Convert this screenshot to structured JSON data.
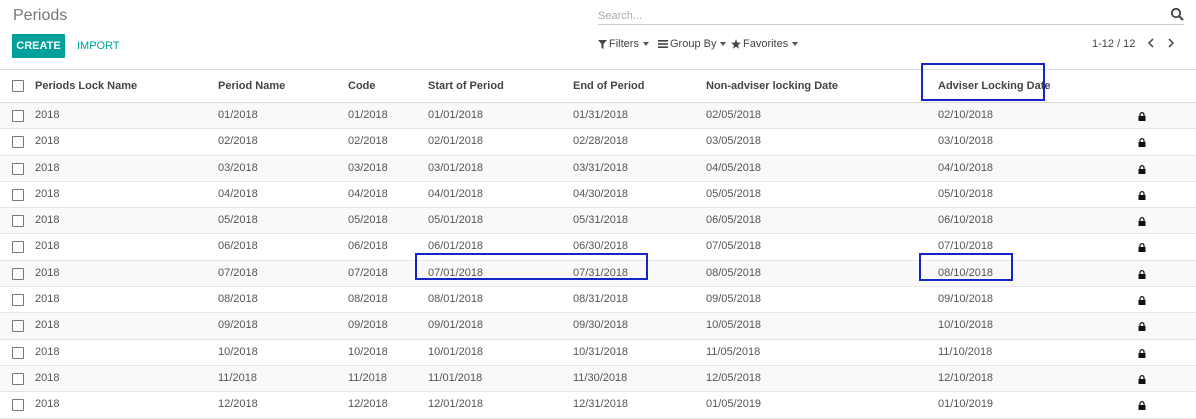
{
  "page": {
    "title": "Periods"
  },
  "search": {
    "placeholder": "Search..."
  },
  "toolbar": {
    "create_label": "CREATE",
    "import_label": "IMPORT",
    "filters_label": "Filters",
    "groupby_label": "Group By",
    "favorites_label": "Favorites",
    "pager_text": "1-12 / 12"
  },
  "accent_color": "#00a09d",
  "highlight_color": "#1426c8",
  "columns": [
    "Periods Lock Name",
    "Period Name",
    "Code",
    "Start of Period",
    "End of Period",
    "Non-adviser locking Date",
    "Adviser Locking Date"
  ],
  "rows": [
    [
      "2018",
      "01/2018",
      "01/2018",
      "01/01/2018",
      "01/31/2018",
      "02/05/2018",
      "02/10/2018"
    ],
    [
      "2018",
      "02/2018",
      "02/2018",
      "02/01/2018",
      "02/28/2018",
      "03/05/2018",
      "03/10/2018"
    ],
    [
      "2018",
      "03/2018",
      "03/2018",
      "03/01/2018",
      "03/31/2018",
      "04/05/2018",
      "04/10/2018"
    ],
    [
      "2018",
      "04/2018",
      "04/2018",
      "04/01/2018",
      "04/30/2018",
      "05/05/2018",
      "05/10/2018"
    ],
    [
      "2018",
      "05/2018",
      "05/2018",
      "05/01/2018",
      "05/31/2018",
      "06/05/2018",
      "06/10/2018"
    ],
    [
      "2018",
      "06/2018",
      "06/2018",
      "06/01/2018",
      "06/30/2018",
      "07/05/2018",
      "07/10/2018"
    ],
    [
      "2018",
      "07/2018",
      "07/2018",
      "07/01/2018",
      "07/31/2018",
      "08/05/2018",
      "08/10/2018"
    ],
    [
      "2018",
      "08/2018",
      "08/2018",
      "08/01/2018",
      "08/31/2018",
      "09/05/2018",
      "09/10/2018"
    ],
    [
      "2018",
      "09/2018",
      "09/2018",
      "09/01/2018",
      "09/30/2018",
      "10/05/2018",
      "10/10/2018"
    ],
    [
      "2018",
      "10/2018",
      "10/2018",
      "10/01/2018",
      "10/31/2018",
      "11/05/2018",
      "11/10/2018"
    ],
    [
      "2018",
      "11/2018",
      "11/2018",
      "11/01/2018",
      "11/30/2018",
      "12/05/2018",
      "12/10/2018"
    ],
    [
      "2018",
      "12/2018",
      "12/2018",
      "12/01/2018",
      "12/31/2018",
      "01/05/2019",
      "01/10/2019"
    ]
  ],
  "icons": {
    "search": "search-icon",
    "row_status": "lock-icon",
    "prev": "chevron-left-icon",
    "next": "chevron-right-icon"
  }
}
